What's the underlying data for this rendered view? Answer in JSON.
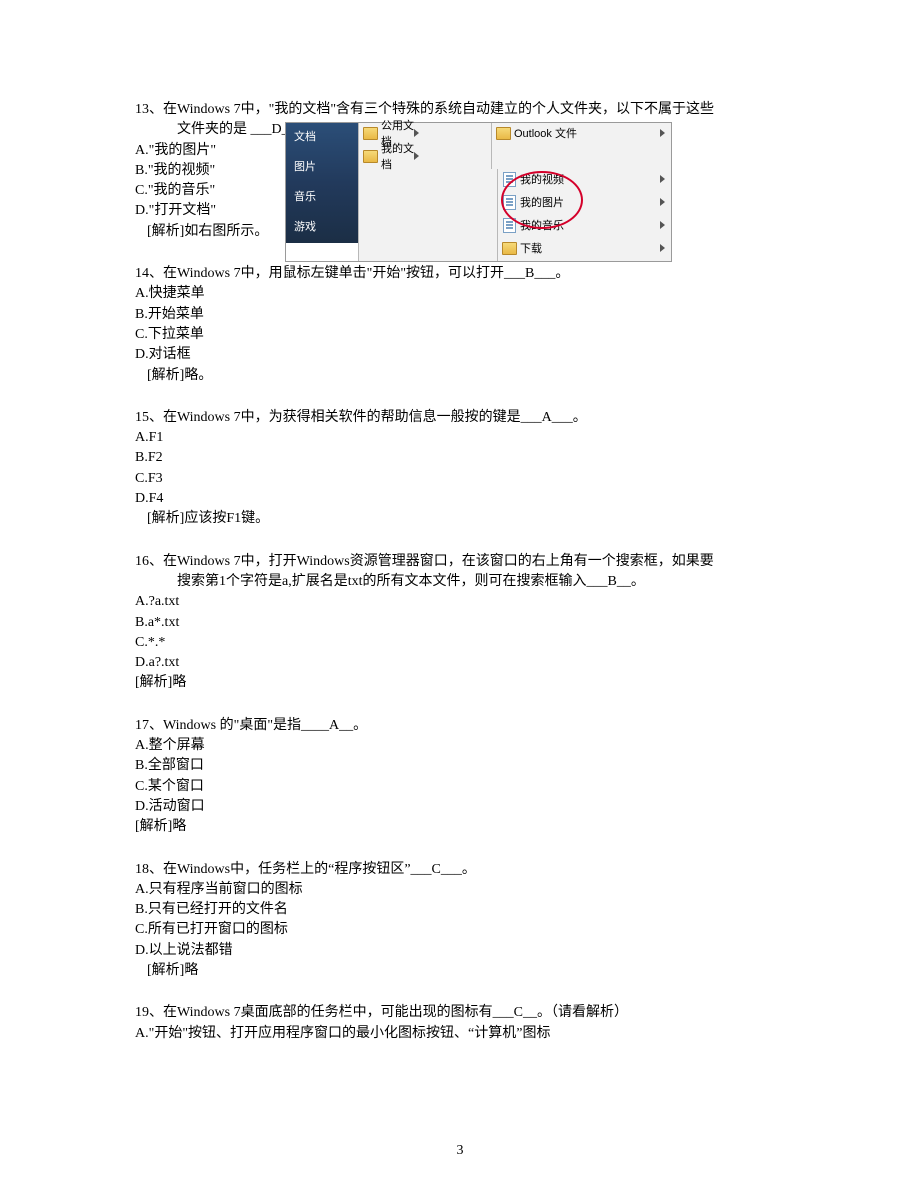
{
  "page_number": "3",
  "q13": {
    "line1": "13、在Windows 7中，\"我的文档\"含有三个特殊的系统自动建立的个人文件夹，以下不属于这些",
    "line2": "文件夹的是 ___D___。",
    "A": "A.\"我的图片\"",
    "B": "B.\"我的视频\"",
    "C": "C.\"我的音乐\"",
    "D": "D.\"打开文档\"",
    "analysis": "[解析]如右图所示。",
    "img": {
      "left": {
        "docs": "文档",
        "pics": "图片",
        "music": "音乐",
        "games": "游戏"
      },
      "col1": {
        "pub": "公用文档",
        "mydoc": "我的文档"
      },
      "col2": {
        "outlook": "Outlook 文件",
        "myvideo": "我的视频",
        "mypic": "我的图片",
        "mymusic": "我的音乐",
        "download": "下载"
      }
    }
  },
  "q14": {
    "q": "14、在Windows 7中，用鼠标左键单击\"开始\"按钮，可以打开___B___。",
    "A": "A.快捷菜单",
    "B": "B.开始菜单",
    "C": "C.下拉菜单",
    "D": "D.对话框",
    "analysis": "[解析]略。"
  },
  "q15": {
    "q": "15、在Windows 7中，为获得相关软件的帮助信息一般按的键是___A___。",
    "A": "A.F1",
    "B": "B.F2",
    "C": "C.F3",
    "D": "D.F4",
    "analysis": "[解析]应该按F1键。"
  },
  "q16": {
    "line1": "16、在Windows 7中，打开Windows资源管理器窗口，在该窗口的右上角有一个搜索框，如果要",
    "line2": "搜索第1个字符是a,扩展名是txt的所有文本文件，则可在搜索框输入___B__。",
    "A": "A.?a.txt",
    "B": "B.a*.txt",
    "C": "C.*.*",
    "D": "D.a?.txt",
    "analysis": "[解析]略"
  },
  "q17": {
    "q": "17、Windows 的\"桌面\"是指____A__。",
    "A": "A.整个屏幕",
    "B": "B.全部窗口",
    "C": "C.某个窗口",
    "D": "D.活动窗口",
    "analysis": "[解析]略"
  },
  "q18": {
    "q": "18、在Windows中，任务栏上的“程序按钮区”___C___。",
    "A": "A.只有程序当前窗口的图标",
    "B": "B.只有已经打开的文件名",
    "C": "C.所有已打开窗口的图标",
    "D": "D.以上说法都错",
    "analysis": "[解析]略"
  },
  "q19": {
    "q": "19、在Windows 7桌面底部的任务栏中，可能出现的图标有___C__。（请看解析）",
    "A": "A.\"开始\"按钮、打开应用程序窗口的最小化图标按钮、“计算机”图标"
  }
}
